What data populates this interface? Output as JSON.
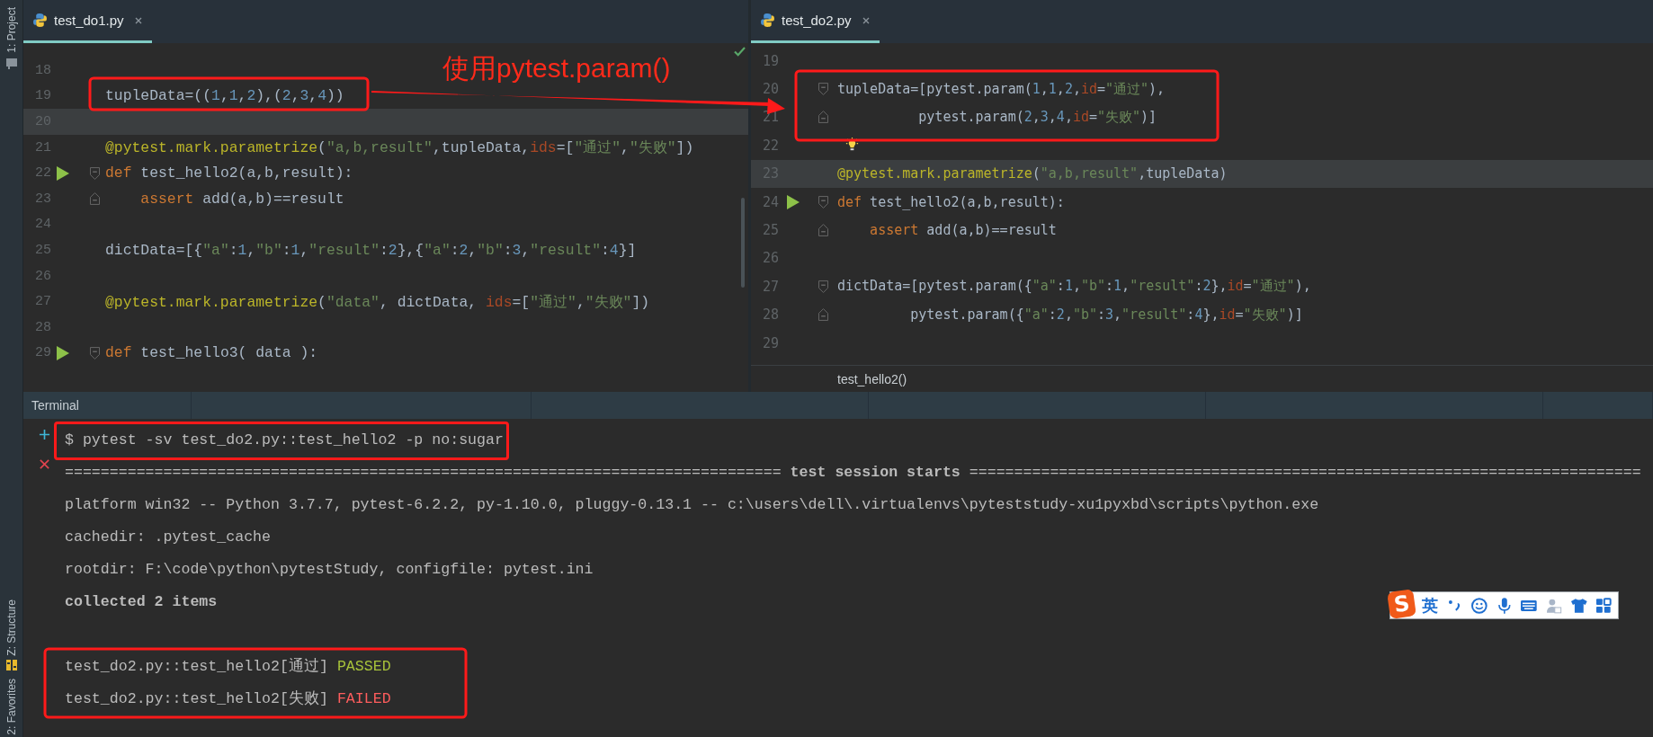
{
  "tool_strip": {
    "top": [
      {
        "label": "1: Project"
      }
    ],
    "bottom": [
      {
        "label": "Z: Structure"
      },
      {
        "label": "2: Favorites"
      }
    ]
  },
  "editors": [
    {
      "tabs": [
        {
          "label": "test_do1.py",
          "selected": true
        }
      ],
      "lines": [
        {
          "number": "18",
          "current": false,
          "kind": "plain"
        },
        {
          "number": "19",
          "current": false,
          "kind": "plain",
          "segments": [
            {
              "text": "tupleData=((",
              "kind": "plain"
            },
            {
              "text": "1",
              "kind": "num"
            },
            {
              "text": ",",
              "kind": "plain"
            },
            {
              "text": "1",
              "kind": "num"
            },
            {
              "text": ",",
              "kind": "plain"
            },
            {
              "text": "2",
              "kind": "num"
            },
            {
              "text": "),(",
              "kind": "plain"
            },
            {
              "text": "2",
              "kind": "num"
            },
            {
              "text": ",",
              "kind": "plain"
            },
            {
              "text": "3",
              "kind": "num"
            },
            {
              "text": ",",
              "kind": "plain"
            },
            {
              "text": "4",
              "kind": "num"
            },
            {
              "text": "))",
              "kind": "plain"
            }
          ]
        },
        {
          "number": "20",
          "current": true,
          "kind": "plain"
        },
        {
          "number": "21",
          "current": false,
          "kind": "plain",
          "segments": [
            {
              "text": "@pytest.mark.parametrize",
              "kind": "deco"
            },
            {
              "text": "(",
              "kind": "plain"
            },
            {
              "text": "\"a,b,result\"",
              "kind": "str"
            },
            {
              "text": ",tupleData,",
              "kind": "plain"
            },
            {
              "text": "ids",
              "kind": "param"
            },
            {
              "text": "=[",
              "kind": "plain"
            },
            {
              "text": "\"通过\"",
              "kind": "str"
            },
            {
              "text": ",",
              "kind": "plain"
            },
            {
              "text": "\"失败\"",
              "kind": "str"
            },
            {
              "text": "])",
              "kind": "plain"
            }
          ]
        },
        {
          "number": "22",
          "current": false,
          "kind": "run",
          "segments": [
            {
              "text": "def",
              "kind": "kw"
            },
            {
              "text": " test_hello2(a,b,result):",
              "kind": "plain"
            }
          ]
        },
        {
          "number": "23",
          "current": false,
          "kind": "fold_end",
          "segments": [
            {
              "text": "    assert",
              "kind": "kw"
            },
            {
              "text": " add(a,b)==result",
              "kind": "plain"
            }
          ]
        },
        {
          "number": "24",
          "current": false,
          "kind": "plain"
        },
        {
          "number": "25",
          "current": false,
          "kind": "plain",
          "segments": [
            {
              "text": "dictData=[{",
              "kind": "plain"
            },
            {
              "text": "\"a\"",
              "kind": "str"
            },
            {
              "text": ":",
              "kind": "plain"
            },
            {
              "text": "1",
              "kind": "num"
            },
            {
              "text": ",",
              "kind": "plain"
            },
            {
              "text": "\"b\"",
              "kind": "str"
            },
            {
              "text": ":",
              "kind": "plain"
            },
            {
              "text": "1",
              "kind": "num"
            },
            {
              "text": ",",
              "kind": "plain"
            },
            {
              "text": "\"result\"",
              "kind": "str"
            },
            {
              "text": ":",
              "kind": "plain"
            },
            {
              "text": "2",
              "kind": "num"
            },
            {
              "text": "},{",
              "kind": "plain"
            },
            {
              "text": "\"a\"",
              "kind": "str"
            },
            {
              "text": ":",
              "kind": "plain"
            },
            {
              "text": "2",
              "kind": "num"
            },
            {
              "text": ",",
              "kind": "plain"
            },
            {
              "text": "\"b\"",
              "kind": "str"
            },
            {
              "text": ":",
              "kind": "plain"
            },
            {
              "text": "3",
              "kind": "num"
            },
            {
              "text": ",",
              "kind": "plain"
            },
            {
              "text": "\"result\"",
              "kind": "str"
            },
            {
              "text": ":",
              "kind": "plain"
            },
            {
              "text": "4",
              "kind": "num"
            },
            {
              "text": "}]",
              "kind": "plain"
            }
          ]
        },
        {
          "number": "26",
          "current": false,
          "kind": "plain"
        },
        {
          "number": "27",
          "current": false,
          "kind": "plain",
          "segments": [
            {
              "text": "@pytest.mark.parametrize",
              "kind": "deco"
            },
            {
              "text": "(",
              "kind": "plain"
            },
            {
              "text": "\"data\"",
              "kind": "str"
            },
            {
              "text": ", dictData, ",
              "kind": "plain"
            },
            {
              "text": "ids",
              "kind": "param"
            },
            {
              "text": "=[",
              "kind": "plain"
            },
            {
              "text": "\"通过\"",
              "kind": "str"
            },
            {
              "text": ",",
              "kind": "plain"
            },
            {
              "text": "\"失败\"",
              "kind": "str"
            },
            {
              "text": "])",
              "kind": "plain"
            }
          ]
        },
        {
          "number": "28",
          "current": false,
          "kind": "plain"
        },
        {
          "number": "29",
          "current": false,
          "kind": "run",
          "segments": [
            {
              "text": "def",
              "kind": "kw"
            },
            {
              "text": " test_hello3( data ):",
              "kind": "plain"
            }
          ]
        }
      ]
    },
    {
      "tabs": [
        {
          "label": "test_do2.py",
          "selected": true
        }
      ],
      "lines": [
        {
          "number": "19",
          "current": false,
          "kind": "plain"
        },
        {
          "number": "20",
          "current": false,
          "kind": "fold_start",
          "segments": [
            {
              "text": "tupleData=[pytest.param(",
              "kind": "plain"
            },
            {
              "text": "1",
              "kind": "num"
            },
            {
              "text": ",",
              "kind": "plain"
            },
            {
              "text": "1",
              "kind": "num"
            },
            {
              "text": ",",
              "kind": "plain"
            },
            {
              "text": "2",
              "kind": "num"
            },
            {
              "text": ",",
              "kind": "plain"
            },
            {
              "text": "id",
              "kind": "param"
            },
            {
              "text": "=",
              "kind": "plain"
            },
            {
              "text": "\"通过\"",
              "kind": "str"
            },
            {
              "text": "),",
              "kind": "plain"
            }
          ]
        },
        {
          "number": "21",
          "current": false,
          "kind": "fold_end",
          "segments": [
            {
              "text": "          pytest.param(",
              "kind": "plain"
            },
            {
              "text": "2",
              "kind": "num"
            },
            {
              "text": ",",
              "kind": "plain"
            },
            {
              "text": "3",
              "kind": "num"
            },
            {
              "text": ",",
              "kind": "plain"
            },
            {
              "text": "4",
              "kind": "num"
            },
            {
              "text": ",",
              "kind": "plain"
            },
            {
              "text": "id",
              "kind": "param"
            },
            {
              "text": "=",
              "kind": "plain"
            },
            {
              "text": "\"失败\"",
              "kind": "str"
            },
            {
              "text": ")]",
              "kind": "plain"
            }
          ]
        },
        {
          "number": "22",
          "current": false,
          "kind": "bulb"
        },
        {
          "number": "23",
          "current": true,
          "kind": "plain",
          "segments": [
            {
              "text": "@pytest.mark.parametrize",
              "kind": "deco"
            },
            {
              "text": "(",
              "kind": "plain"
            },
            {
              "text": "\"a,b,result\"",
              "kind": "str"
            },
            {
              "text": ",tupleData)",
              "kind": "plain"
            }
          ]
        },
        {
          "number": "24",
          "current": false,
          "kind": "run",
          "segments": [
            {
              "text": "def",
              "kind": "kw"
            },
            {
              "text": " test_hello2(a,b,result):",
              "kind": "plain"
            }
          ]
        },
        {
          "number": "25",
          "current": false,
          "kind": "fold_end",
          "segments": [
            {
              "text": "    assert",
              "kind": "kw"
            },
            {
              "text": " add(a,b)==result",
              "kind": "plain"
            }
          ]
        },
        {
          "number": "26",
          "current": false,
          "kind": "plain"
        },
        {
          "number": "27",
          "current": false,
          "kind": "fold_start",
          "segments": [
            {
              "text": "dictData=[pytest.param({",
              "kind": "plain"
            },
            {
              "text": "\"a\"",
              "kind": "str"
            },
            {
              "text": ":",
              "kind": "plain"
            },
            {
              "text": "1",
              "kind": "num"
            },
            {
              "text": ",",
              "kind": "plain"
            },
            {
              "text": "\"b\"",
              "kind": "str"
            },
            {
              "text": ":",
              "kind": "plain"
            },
            {
              "text": "1",
              "kind": "num"
            },
            {
              "text": ",",
              "kind": "plain"
            },
            {
              "text": "\"result\"",
              "kind": "str"
            },
            {
              "text": ":",
              "kind": "plain"
            },
            {
              "text": "2",
              "kind": "num"
            },
            {
              "text": "},",
              "kind": "plain"
            },
            {
              "text": "id",
              "kind": "param"
            },
            {
              "text": "=",
              "kind": "plain"
            },
            {
              "text": "\"通过\"",
              "kind": "str"
            },
            {
              "text": "),",
              "kind": "plain"
            }
          ]
        },
        {
          "number": "28",
          "current": false,
          "kind": "fold_end",
          "segments": [
            {
              "text": "         pytest.param({",
              "kind": "plain"
            },
            {
              "text": "\"a\"",
              "kind": "str"
            },
            {
              "text": ":",
              "kind": "plain"
            },
            {
              "text": "2",
              "kind": "num"
            },
            {
              "text": ",",
              "kind": "plain"
            },
            {
              "text": "\"b\"",
              "kind": "str"
            },
            {
              "text": ":",
              "kind": "plain"
            },
            {
              "text": "3",
              "kind": "num"
            },
            {
              "text": ",",
              "kind": "plain"
            },
            {
              "text": "\"result\"",
              "kind": "str"
            },
            {
              "text": ":",
              "kind": "plain"
            },
            {
              "text": "4",
              "kind": "num"
            },
            {
              "text": "},",
              "kind": "plain"
            },
            {
              "text": "id",
              "kind": "param"
            },
            {
              "text": "=",
              "kind": "plain"
            },
            {
              "text": "\"失败\"",
              "kind": "str"
            },
            {
              "text": ")]",
              "kind": "plain"
            }
          ]
        },
        {
          "number": "29",
          "current": false,
          "kind": "plain"
        }
      ],
      "breadcrumb": "test_hello2()"
    }
  ],
  "terminal": {
    "title": "Terminal",
    "lines": [
      {
        "kind": "command",
        "text": "$ pytest -sv test_do2.py::test_hello2 -p no:sugar"
      },
      {
        "kind": "plain",
        "text": "================================================================================ **test session starts** ==========================================================================="
      },
      {
        "kind": "plain",
        "text": "platform win32 -- Python 3.7.7, pytest-6.2.2, py-1.10.0, pluggy-0.13.1 -- c:\\users\\dell\\.virtualenvs\\pyteststudy-xu1pyxbd\\scripts\\python.exe"
      },
      {
        "kind": "plain",
        "text": "cachedir: .pytest_cache"
      },
      {
        "kind": "plain",
        "text": "rootdir: F:\\code\\python\\pytestStudy, configfile: pytest.ini"
      },
      {
        "kind": "bold",
        "text": "collected 2 items"
      }
    ],
    "results": [
      {
        "text": "test_do2.py::test_hello2[通过]",
        "status": "PASSED",
        "kind": "passed"
      },
      {
        "text": "test_do2.py::test_hello2[失败]",
        "status": "FAILED",
        "kind": "failed"
      }
    ]
  },
  "annotation": {
    "label": "使用pytest.param()"
  },
  "ime_toolbar": {
    "logo": "S",
    "mode": "英"
  }
}
